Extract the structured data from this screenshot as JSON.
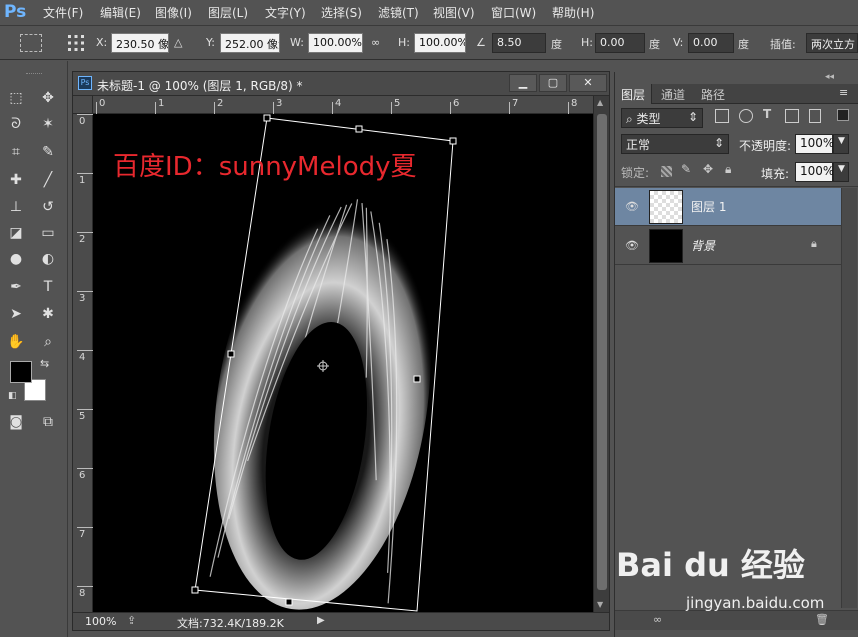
{
  "app": {
    "logo": "Ps"
  },
  "menu": [
    "文件(F)",
    "编辑(E)",
    "图像(I)",
    "图层(L)",
    "文字(Y)",
    "选择(S)",
    "滤镜(T)",
    "视图(V)",
    "窗口(W)",
    "帮助(H)"
  ],
  "options": {
    "x_label": "X:",
    "x_value": "230.50 像素",
    "y_label": "Y:",
    "y_value": "252.00 像素",
    "w_label": "W:",
    "w_value": "100.00%",
    "h_label": "H:",
    "h_value": "100.00%",
    "angle_value": "8.50",
    "angle_unit": "度",
    "hskew_label": "H:",
    "hskew_value": "0.00",
    "hskew_unit": "度",
    "vskew_label": "V:",
    "vskew_value": "0.00",
    "vskew_unit": "度",
    "interp_label": "插值:",
    "interp_value": "两次立方"
  },
  "document": {
    "title": "未标题-1 @ 100% (图层 1, RGB/8) *",
    "zoom": "100%",
    "doc_size": "文档:732.4K/189.2K",
    "watermark": "百度ID：sunnyMelody夏",
    "ruler_top": [
      "0",
      "1",
      "2",
      "3",
      "4",
      "5",
      "6",
      "7",
      "8"
    ],
    "ruler_left": [
      "0",
      "1",
      "2",
      "3",
      "4",
      "5",
      "6",
      "7",
      "8"
    ]
  },
  "layers_panel": {
    "tabs": [
      "图层",
      "通道",
      "路径"
    ],
    "filter_kind": "类型",
    "blend_mode": "正常",
    "opacity_label": "不透明度:",
    "opacity_value": "100%",
    "lock_label": "锁定:",
    "fill_label": "填充:",
    "fill_value": "100%",
    "layers": [
      {
        "name": "图层 1",
        "selected": true
      },
      {
        "name": "背景",
        "selected": false
      }
    ]
  },
  "baidu": {
    "logo_text": "Bai du 经验",
    "url": "jingyan.baidu.com"
  },
  "colors": {
    "accent_red": "#e8282e",
    "selection_blue": "#6e86a2",
    "panel_gray": "#535353"
  }
}
